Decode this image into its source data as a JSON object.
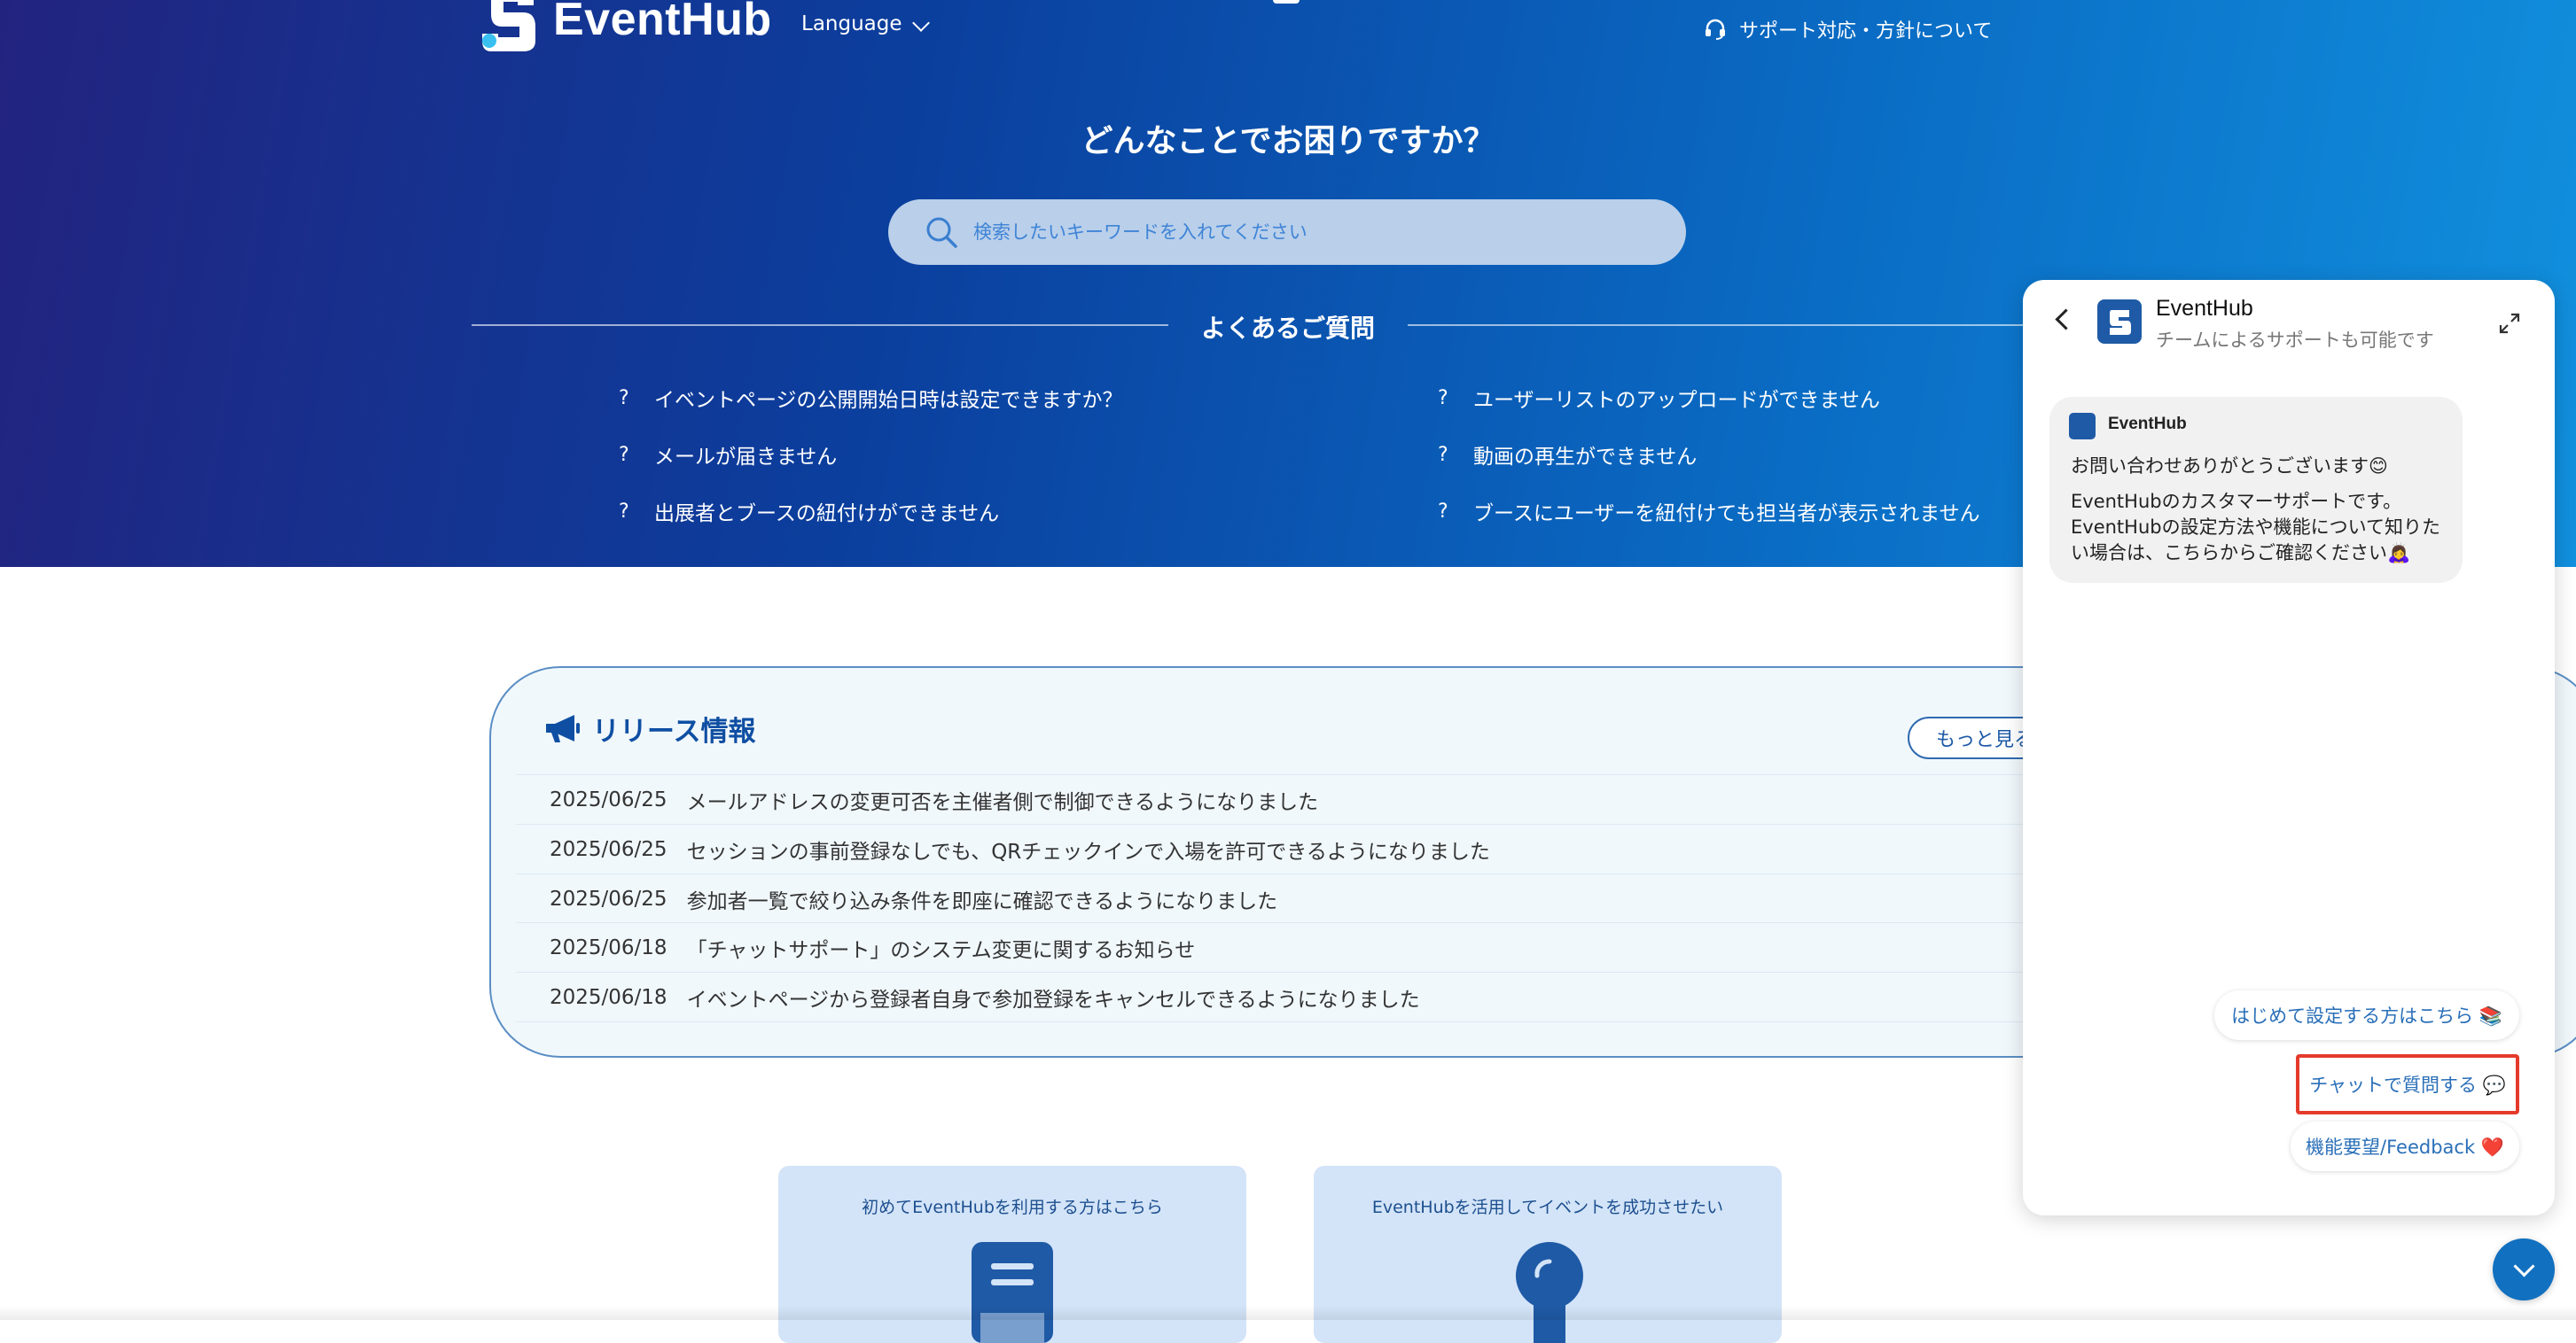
{
  "header": {
    "brand": "EventHub",
    "language_label": "Language",
    "support_label": "サポート対応・方針について"
  },
  "hero": {
    "title": "どんなことでお困りですか？",
    "search_placeholder": "検索したいキーワードを入れてください"
  },
  "faq": {
    "title": "よくあるご質問",
    "left": [
      "イベントページの公開開始日時は設定できますか？",
      "メールが届きません",
      "出展者とブースの紐付けができません"
    ],
    "right": [
      "ユーザーリストのアップロードができません",
      "動画の再生ができません",
      "ブースにユーザーを紐付けても担当者が表示されません"
    ],
    "mark": "?"
  },
  "release": {
    "title": "リリース情報",
    "more_label": "もっと見る",
    "items": [
      {
        "date": "2025/06/25",
        "text": "メールアドレスの変更可否を主催者側で制御できるようになりました"
      },
      {
        "date": "2025/06/25",
        "text": "セッションの事前登録なしでも、QRチェックインで入場を許可できるようになりました"
      },
      {
        "date": "2025/06/25",
        "text": "参加者一覧で絞り込み条件を即座に確認できるようになりました"
      },
      {
        "date": "2025/06/18",
        "text": "「チャットサポート」のシステム変更に関するお知らせ"
      },
      {
        "date": "2025/06/18",
        "text": "イベントページから登録者自身で参加登録をキャンセルできるようになりました"
      }
    ]
  },
  "cards": [
    {
      "label": "初めてEventHubを利用する方はこちら",
      "icon": "book-icon"
    },
    {
      "label": "EventHubを活用してイベントを成功させたい",
      "icon": "lightbulb-icon"
    }
  ],
  "chat": {
    "name": "EventHub",
    "subtitle": "チームによるサポートも可能です",
    "message": {
      "sender": "EventHub",
      "line1": "お問い合わせありがとうございます😊",
      "line2": "EventHubのカスタマーサポートです。EventHubの設定方法や機能について知りたい場合は、こちらからご確認ください🙇‍♀️"
    },
    "quick_replies": [
      "はじめて設定する方はこちら 📚",
      "チャットで質問する 💬",
      "機能要望/Feedback ❤️"
    ]
  },
  "colors": {
    "hero_start": "#22237f",
    "hero_end": "#1190de",
    "accent": "#1170bf",
    "highlight": "#e53a2b"
  }
}
